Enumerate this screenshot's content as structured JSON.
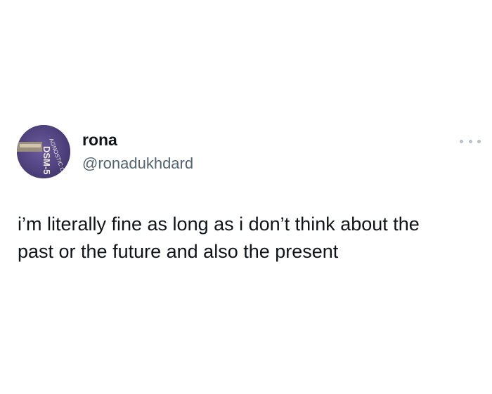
{
  "author": {
    "display_name": "rona",
    "handle": "@ronadukhdard",
    "avatar_icon": "avatar-photo-icon",
    "avatar_text_1": "DSM-5",
    "avatar_text_2": "AGNOSTIC CRI"
  },
  "menu": {
    "icon": "more-options-icon"
  },
  "tweet": {
    "line_1": "i’m literally fine as long as i don’t think about the",
    "line_2": "past or the future and also the present"
  },
  "colors": {
    "text_primary": "#0f1419",
    "text_secondary": "#536471",
    "avatar_background": "#4b3f7a",
    "dots": "#b8c0c7"
  }
}
